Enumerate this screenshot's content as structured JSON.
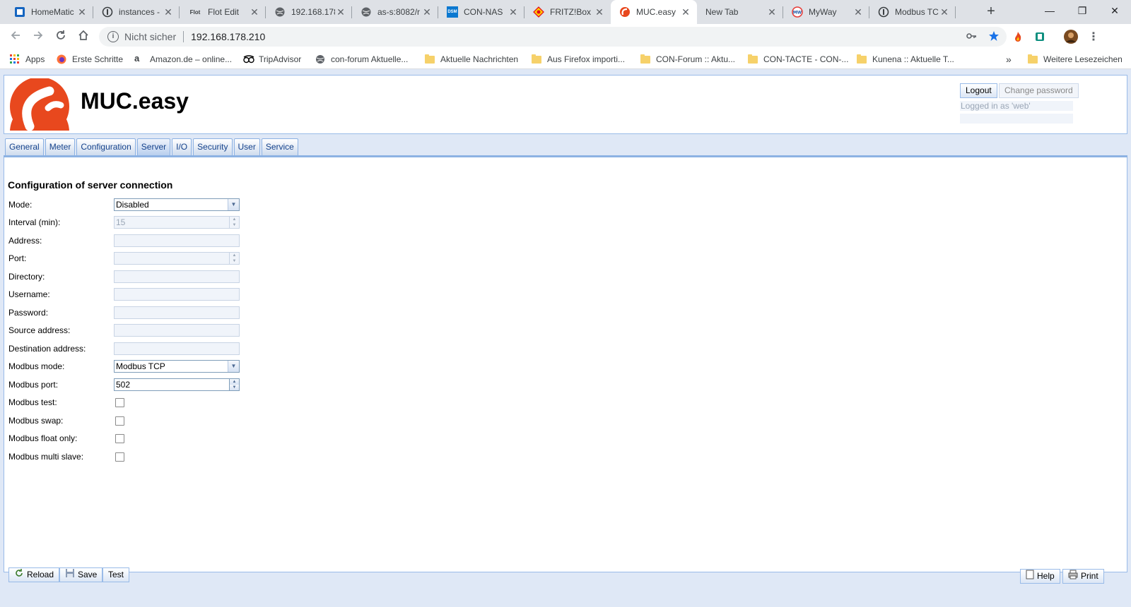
{
  "browser": {
    "tabs": [
      {
        "title": "HomeMatic",
        "icon": "homematic-icon",
        "color": "#1a73e8"
      },
      {
        "title": "instances -",
        "icon": "iobroker-icon",
        "color": "#3c4043"
      },
      {
        "title": "Flot Edit",
        "icon": "flot-icon",
        "favtext": "Flot",
        "color": "#3c4043"
      },
      {
        "title": "192.168.178",
        "icon": "globe-icon",
        "color": "#5f6368"
      },
      {
        "title": "as-s:8082/r",
        "icon": "globe-icon",
        "color": "#5f6368"
      },
      {
        "title": "CON-NAS",
        "icon": "dsm-icon",
        "favtext": "DSM",
        "color": "#0b78d0"
      },
      {
        "title": "FRITZ!Box",
        "icon": "fritzbox-icon",
        "color": "#e2001a"
      },
      {
        "title": "MUC.easy",
        "icon": "muc-easy-icon",
        "color": "#e8481e"
      },
      {
        "title": "New Tab",
        "icon": "",
        "color": "#3c4043"
      },
      {
        "title": "MyWay",
        "icon": "myway-icon",
        "color": "#e53935"
      },
      {
        "title": "Modbus TC",
        "icon": "iobroker-icon",
        "color": "#3c4043"
      }
    ],
    "tab_close": "✕",
    "new_tab": "+",
    "window": {
      "minimize": "—",
      "maximize": "❐",
      "close": "✕"
    },
    "omnibox": {
      "security": "Nicht sicher",
      "url": "192.168.178.210"
    },
    "bookmarks": [
      {
        "label": "Apps",
        "type": "apps"
      },
      {
        "label": "Erste Schritte",
        "type": "firefox"
      },
      {
        "label": "Amazon.de – online...",
        "type": "amazon"
      },
      {
        "label": "TripAdvisor",
        "type": "tripadvisor"
      },
      {
        "label": "con-forum Aktuelle...",
        "type": "globe"
      },
      {
        "label": "Aktuelle Nachrichten",
        "type": "folder"
      },
      {
        "label": "Aus Firefox importi...",
        "type": "folder"
      },
      {
        "label": "CON-Forum :: Aktu...",
        "type": "folder"
      },
      {
        "label": "CON-TACTE - CON-...",
        "type": "folder"
      },
      {
        "label": "Kunena :: Aktuelle T...",
        "type": "folder"
      }
    ],
    "bookmarks_more": "»",
    "other_bookmarks": "Weitere Lesezeichen"
  },
  "app": {
    "brand": "MUC.easy",
    "logout_label": "Logout",
    "change_password_label": "Change password",
    "logged_in_text": "Logged in as 'web'",
    "tabs": [
      "General",
      "Meter",
      "Configuration",
      "Server",
      "I/O",
      "Security",
      "User",
      "Service"
    ],
    "active_tab": "Server",
    "section_title": "Configuration of server connection",
    "form": {
      "mode": {
        "label": "Mode:",
        "value": "Disabled"
      },
      "interval": {
        "label": "Interval (min):",
        "value": "15"
      },
      "address": {
        "label": "Address:",
        "value": ""
      },
      "port": {
        "label": "Port:",
        "value": ""
      },
      "directory": {
        "label": "Directory:",
        "value": ""
      },
      "username": {
        "label": "Username:",
        "value": ""
      },
      "password": {
        "label": "Password:",
        "value": ""
      },
      "source_address": {
        "label": "Source address:",
        "value": ""
      },
      "destination_address": {
        "label": "Destination address:",
        "value": ""
      },
      "modbus_mode": {
        "label": "Modbus mode:",
        "value": "Modbus TCP"
      },
      "modbus_port": {
        "label": "Modbus port:",
        "value": "502"
      },
      "modbus_test": {
        "label": "Modbus test:"
      },
      "modbus_swap": {
        "label": "Modbus swap:"
      },
      "modbus_float_only": {
        "label": "Modbus float only:"
      },
      "modbus_multi_slave": {
        "label": "Modbus multi slave:"
      }
    },
    "footer": {
      "reload_label": "Reload",
      "save_label": "Save",
      "test_label": "Test",
      "help_label": "Help",
      "print_label": "Print"
    },
    "colors": {
      "accent": "#e8481e",
      "panel_border": "#99bbe8",
      "tab_text": "#15428b"
    }
  }
}
